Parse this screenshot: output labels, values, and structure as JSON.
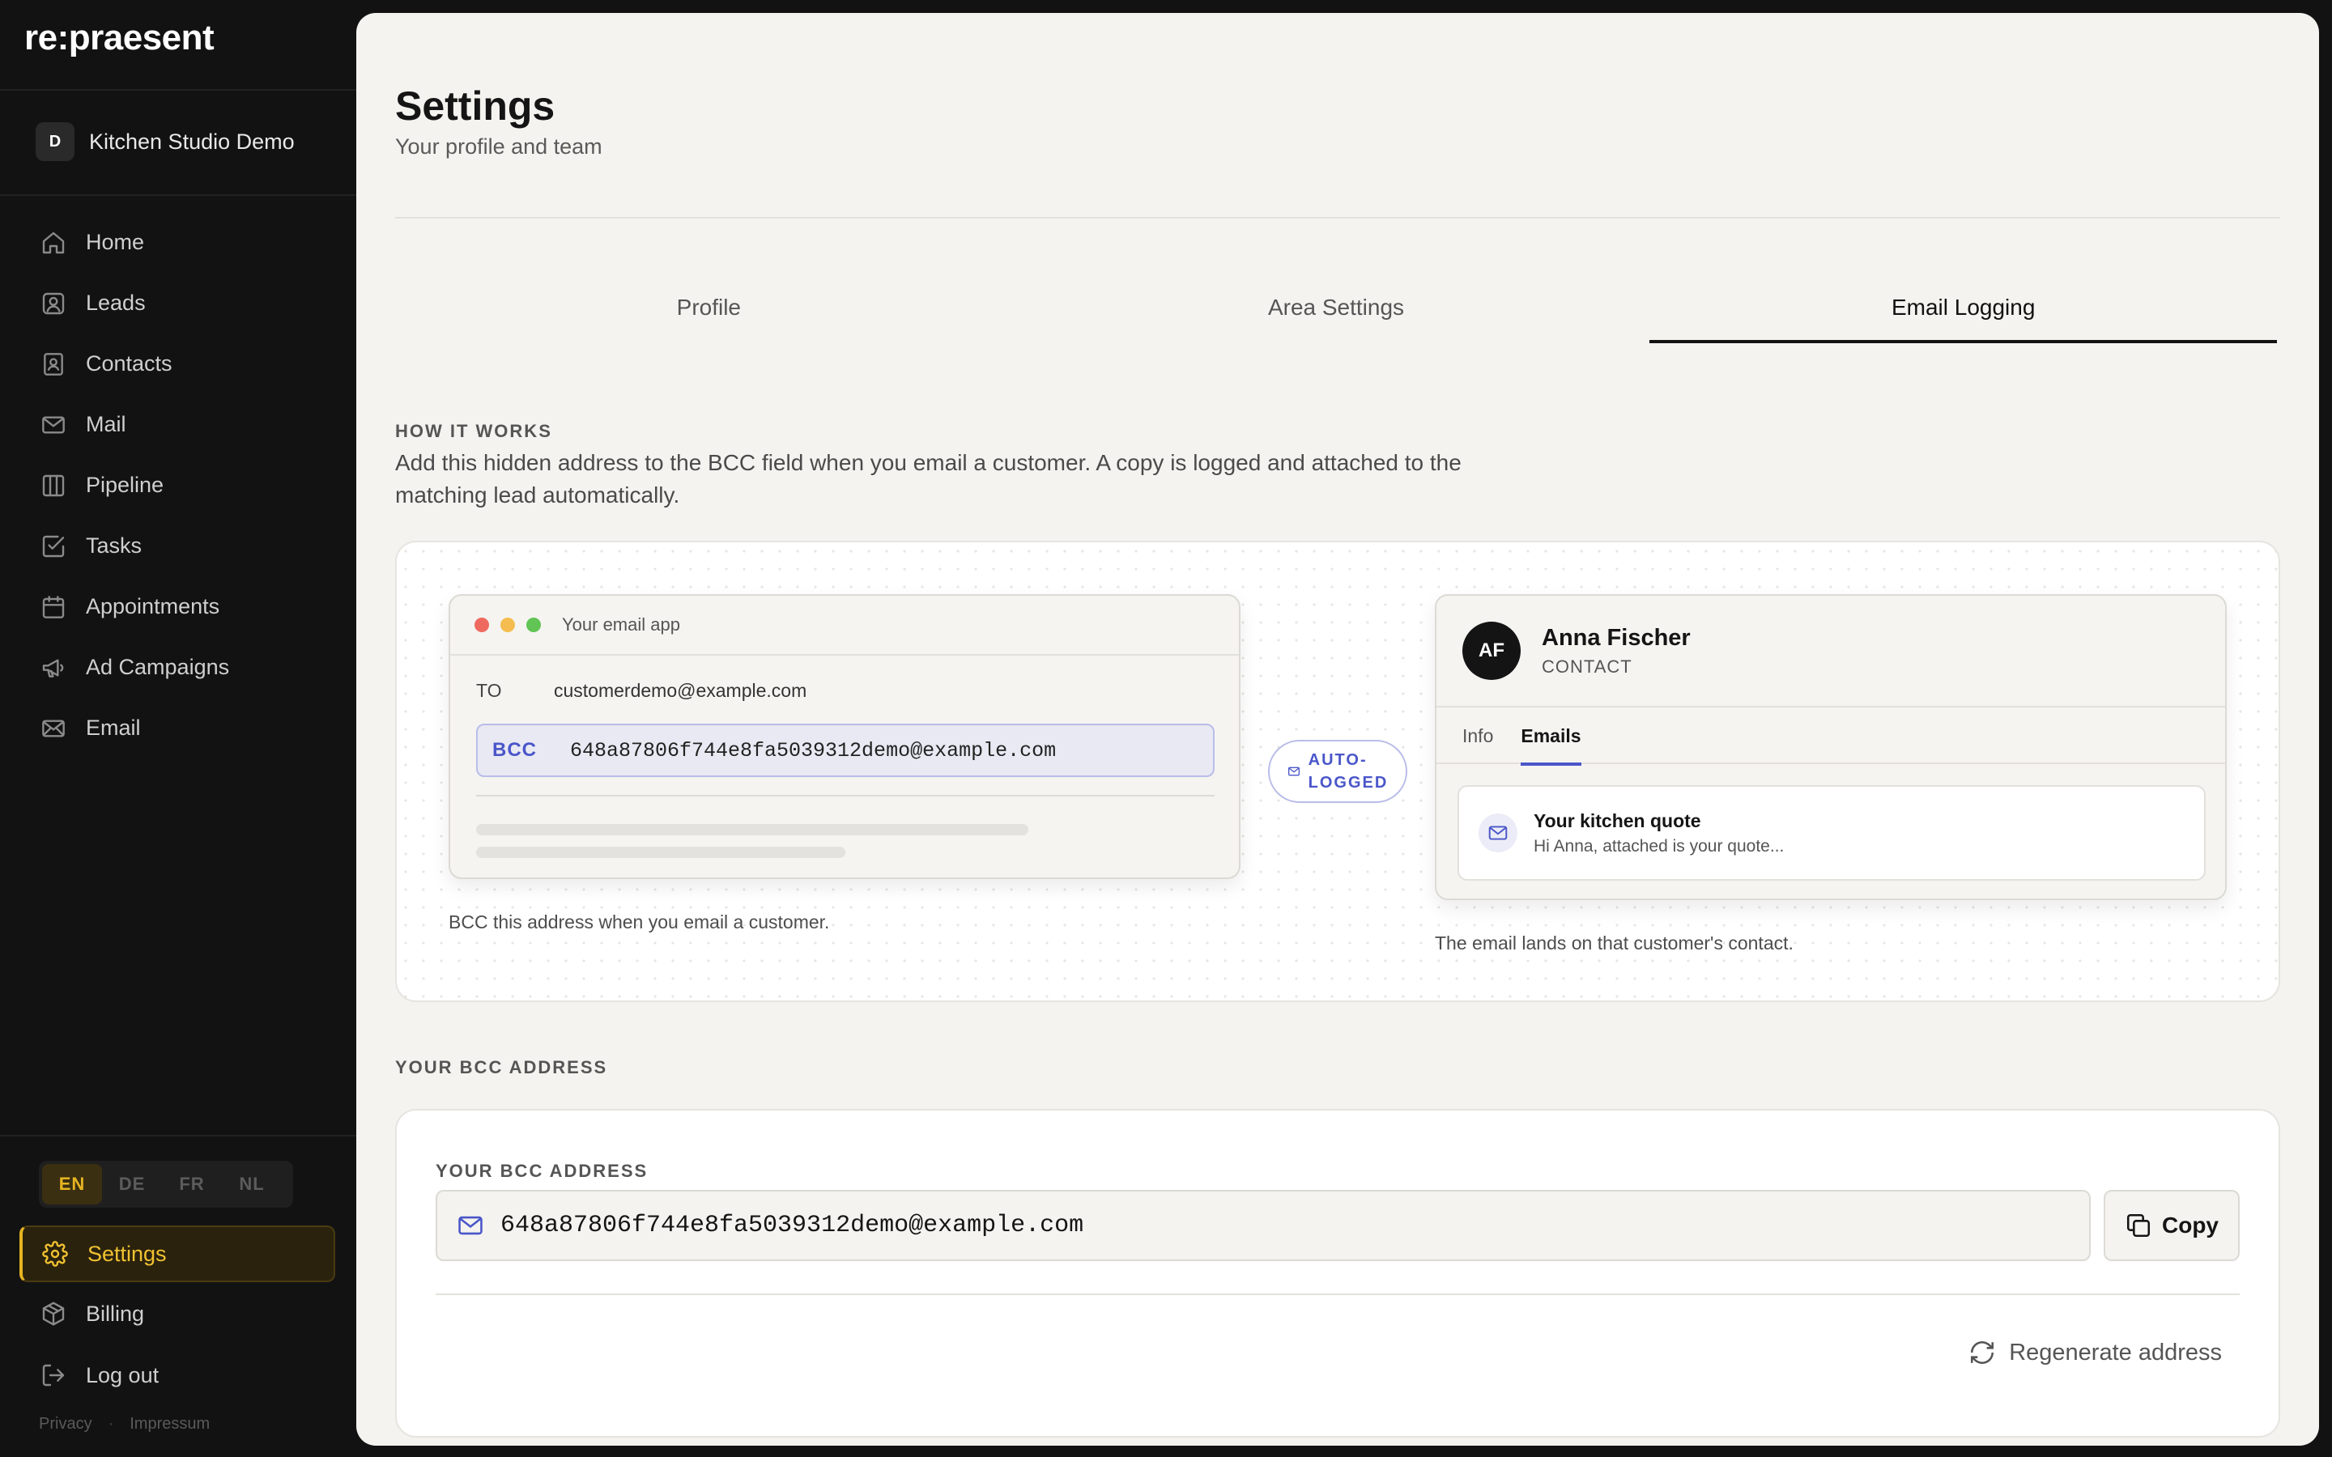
{
  "app": {
    "logo": "re:praesent"
  },
  "workspace": {
    "initial": "D",
    "name": "Kitchen Studio Demo"
  },
  "nav": {
    "items": [
      {
        "label": "Home",
        "icon": "home-icon"
      },
      {
        "label": "Leads",
        "icon": "user-square-icon"
      },
      {
        "label": "Contacts",
        "icon": "contact-book-icon"
      },
      {
        "label": "Mail",
        "icon": "mail-icon"
      },
      {
        "label": "Pipeline",
        "icon": "columns-icon"
      },
      {
        "label": "Tasks",
        "icon": "checkbox-icon"
      },
      {
        "label": "Appointments",
        "icon": "calendar-icon"
      },
      {
        "label": "Ad Campaigns",
        "icon": "megaphone-icon"
      },
      {
        "label": "Email",
        "icon": "envelope-open-icon"
      }
    ]
  },
  "languages": {
    "options": [
      "EN",
      "DE",
      "FR",
      "NL"
    ],
    "selected": "EN"
  },
  "sidebar_bottom": {
    "settings": "Settings",
    "billing": "Billing",
    "logout": "Log out",
    "privacy": "Privacy",
    "impressum": "Impressum"
  },
  "page": {
    "title": "Settings",
    "subtitle": "Your profile and team"
  },
  "tabs": [
    {
      "label": "Profile",
      "active": false
    },
    {
      "label": "Area Settings",
      "active": false
    },
    {
      "label": "Email Logging",
      "active": true
    }
  ],
  "how_it_works": {
    "heading": "HOW IT WORKS",
    "text": "Add this hidden address to the BCC field when you email a customer. A copy is logged and attached to the matching lead automatically."
  },
  "illustration": {
    "email_app": {
      "title": "Your email app",
      "to_label": "TO",
      "to_value": "customerdemo@example.com",
      "bcc_label": "BCC",
      "bcc_value": "648a87806f744e8fa5039312demo@example.com",
      "caption": "BCC this address when you email a customer."
    },
    "badge": {
      "line1": "AUTO-",
      "line2": "LOGGED"
    },
    "contact": {
      "initials": "AF",
      "name": "Anna Fischer",
      "role": "CONTACT",
      "tabs": [
        "Info",
        "Emails"
      ],
      "active_tab": "Emails",
      "mail_title": "Your kitchen quote",
      "mail_preview": "Hi Anna, attached is your quote...",
      "caption": "The email lands on that customer's contact."
    }
  },
  "bcc_section": {
    "heading": "YOUR BCC ADDRESS",
    "field_label": "YOUR BCC ADDRESS",
    "address": "648a87806f744e8fa5039312demo@example.com",
    "copy_label": "Copy",
    "regenerate_label": "Regenerate address"
  },
  "colors": {
    "accent": "#4a56c9",
    "highlight": "#e6b422",
    "sidebar_bg": "#121212",
    "main_bg": "#f4f3ef"
  }
}
